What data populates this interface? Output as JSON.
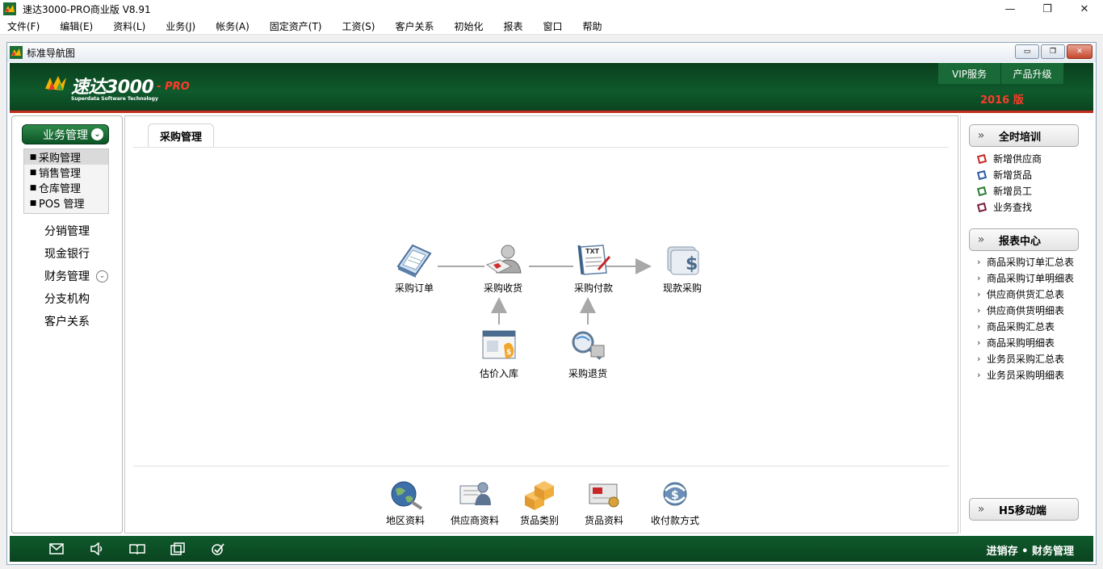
{
  "window": {
    "title": "速达3000-PRO商业版 V8.91",
    "minimize_glyph": "—",
    "maximize_glyph": "❐",
    "close_glyph": "✕"
  },
  "menu": [
    "文件(F)",
    "编辑(E)",
    "资料(L)",
    "业务(J)",
    "帐务(A)",
    "固定资产(T)",
    "工资(S)",
    "客户关系",
    "初始化",
    "报表",
    "窗口",
    "帮助"
  ],
  "subwindow": {
    "title": "标准导航图",
    "min_glyph": "▭",
    "restore_glyph": "❐",
    "close_glyph": "✕"
  },
  "banner": {
    "logo_text": "速达3000",
    "logo_pro": "- PRO",
    "logo_sub": "Superdata Software Technology",
    "tabs": [
      "VIP服务",
      "产品升级"
    ],
    "version": "2016 版",
    "accent": "#c22b1d"
  },
  "left": {
    "active_category": "业务管理",
    "active_chevron": "⌄",
    "sub_items": [
      "采购管理",
      "销售管理",
      "仓库管理",
      "POS 管理"
    ],
    "bullet": "■",
    "categories": [
      "分销管理",
      "现金银行",
      "财务管理",
      "分支机构",
      "客户关系"
    ],
    "finance_chevron": "⌄"
  },
  "center": {
    "tab": "采购管理",
    "flow_nodes": [
      "采购订单",
      "采购收货",
      "采购付款",
      "现款采购",
      "估价入库",
      "采购退货"
    ],
    "bottom_nodes": [
      "地区资料",
      "供应商资料",
      "货品类别",
      "货品资料",
      "收付款方式"
    ]
  },
  "right": {
    "training_head": "全时培训",
    "training_links": [
      "新增供应商",
      "新增货品",
      "新增员工",
      "业务查找"
    ],
    "report_head": "报表中心",
    "report_links": [
      "商品采购订单汇总表",
      "商品采购订单明细表",
      "供应商供货汇总表",
      "供应商供货明细表",
      "商品采购汇总表",
      "商品采购明细表",
      "业务员采购汇总表",
      "业务员采购明细表"
    ],
    "h5_head": "H5移动端",
    "head_glyph": "»",
    "arrow_glyph": "›"
  },
  "status": {
    "right_text": "进销存 • 财务管理",
    "icons": [
      "mail-icon",
      "speaker-icon",
      "book-icon",
      "window-icon",
      "check-icon"
    ]
  },
  "colors": {
    "dark_green": "#0f5a2c",
    "red": "#c22b1d",
    "version_red": "#ff3b2a"
  }
}
